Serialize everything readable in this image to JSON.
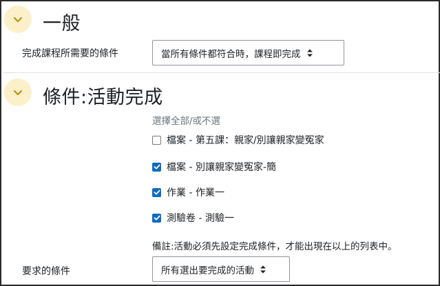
{
  "general": {
    "title": "一般",
    "completion_label": "完成課程所需要的條件",
    "completion_select": "當所有條件都符合時，課程即完成"
  },
  "activity": {
    "title": "條件:活動完成",
    "select_all_link": "選擇全部/或不選",
    "items": [
      {
        "label": "檔案 - 第五課：親家/別讓親家變冤家",
        "checked": false
      },
      {
        "label": "檔案 - 別讓親家變冤家-簡",
        "checked": true
      },
      {
        "label": "作業 - 作業一",
        "checked": true
      },
      {
        "label": "測驗卷 - 測驗一",
        "checked": true
      }
    ],
    "note": "備註:活動必須先設定完成條件，才能出現在以上的列表中。",
    "required_label": "要求的條件",
    "required_select": "所有選出要完成的活動"
  },
  "icons": {
    "section_toggle": "chevron-down-icon",
    "select_caret": "sort-caret-icon",
    "checkmark": "check-icon"
  },
  "colors": {
    "accent": "#0f6cbf",
    "toggle_bg": "#fbf0c9",
    "chevron": "#b78f00"
  }
}
